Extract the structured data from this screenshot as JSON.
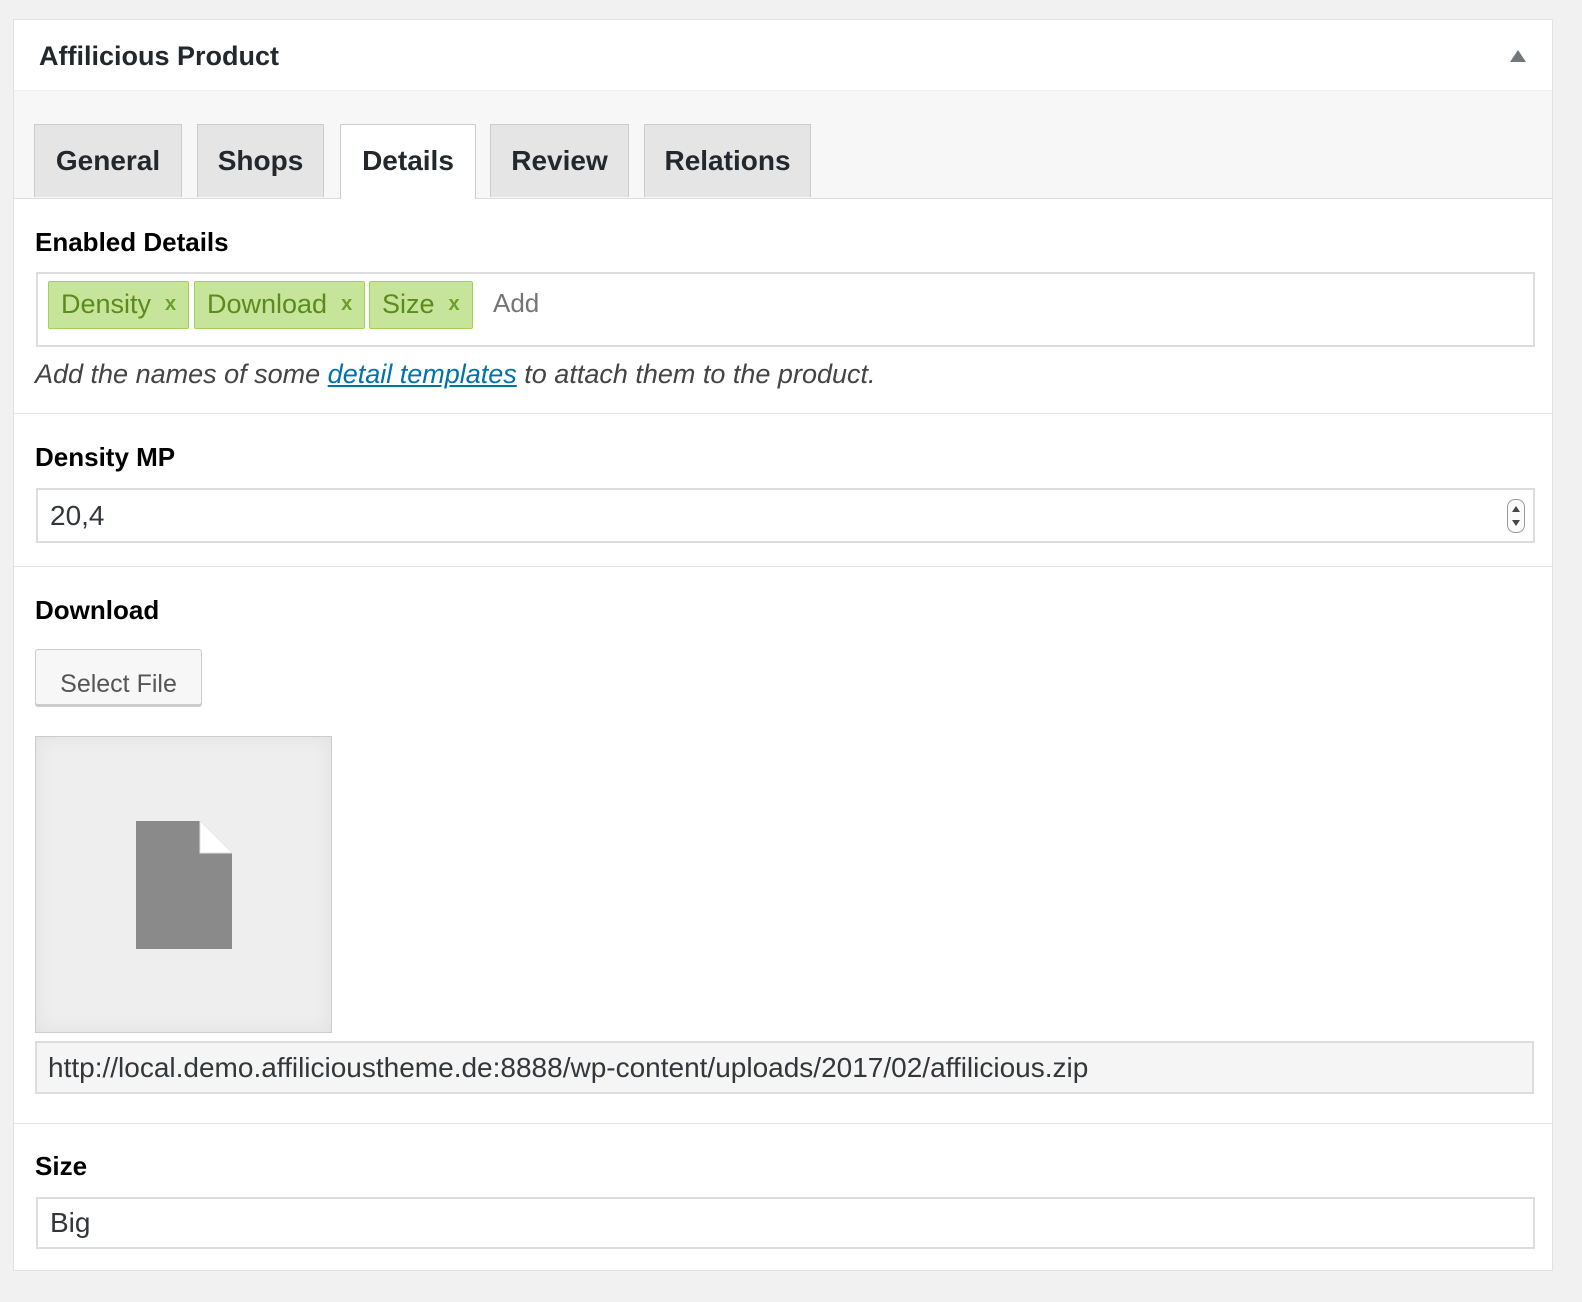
{
  "metabox": {
    "title": "Affilicious Product",
    "toggle_icon": "triangle-up-icon"
  },
  "tabs": [
    {
      "label": "General",
      "active": false
    },
    {
      "label": "Shops",
      "active": false
    },
    {
      "label": "Details",
      "active": true
    },
    {
      "label": "Review",
      "active": false
    },
    {
      "label": "Relations",
      "active": false
    }
  ],
  "enabled_details": {
    "label": "Enabled Details",
    "tags": [
      {
        "label": "Density",
        "remove": "x"
      },
      {
        "label": "Download",
        "remove": "x"
      },
      {
        "label": "Size",
        "remove": "x"
      }
    ],
    "add_placeholder": "Add",
    "hint_before": "Add the names of some ",
    "hint_link": "detail templates",
    "hint_after": " to attach them to the product."
  },
  "density": {
    "label": "Density MP",
    "value": "20,4"
  },
  "download": {
    "label": "Download",
    "button_label": "Select File",
    "file_icon": "document-icon",
    "url": "http://local.demo.affilicioustheme.de:8888/wp-content/uploads/2017/02/affilicious.zip"
  },
  "size": {
    "label": "Size",
    "value": "Big"
  },
  "colors": {
    "tag_bg": "#c7e59a",
    "tag_text": "#5b8a1e",
    "link": "#0073aa"
  }
}
